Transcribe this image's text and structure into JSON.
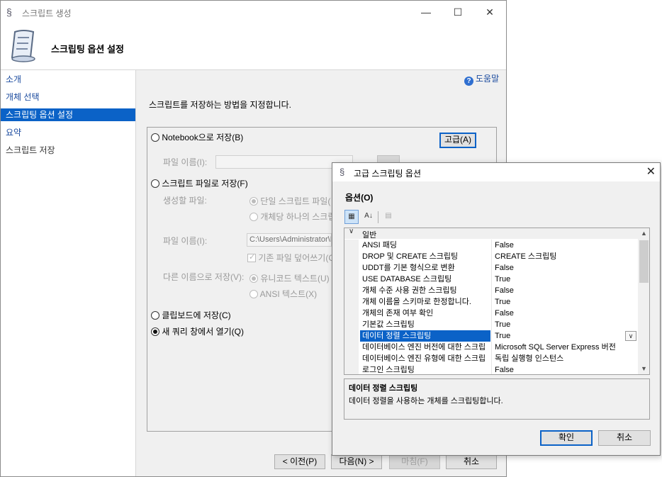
{
  "main_window": {
    "title": "스크립트 생성",
    "header_title": "스크립팅 옵션 설정",
    "sidebar": [
      {
        "label": "소개"
      },
      {
        "label": "개체 선택"
      },
      {
        "label": "스크립팅 옵션 설정"
      },
      {
        "label": "요약"
      },
      {
        "label": "스크립트 저장"
      }
    ],
    "help_label": "도움말",
    "instruction": "스크립트를 저장하는 방법을 지정합니다.",
    "options": {
      "notebook_label": "Notebook으로 저장(B)",
      "advanced_button": "고급(A)",
      "file_name_label_1": "파일 이름(I):",
      "script_file_label": "스크립트 파일로 저장(F)",
      "files_to_generate_label": "생성할 파일:",
      "single_script_label": "단일 스크립트 파일(",
      "one_per_object_label": "개체당 하나의 스크립",
      "file_name_label_2": "파일 이름(I):",
      "file_name_value": "C:\\Users\\Administrator\\D",
      "overwrite_label": "기존 파일 덮어쓰기(C",
      "save_as_label": "다른 이름으로 저장(V):",
      "unicode_label": "유니코드 텍스트(U)",
      "ansi_label": "ANSI 텍스트(X)",
      "clipboard_label": "클립보드에 저장(C)",
      "new_query_label": "새 쿼리 창에서 열기(Q)"
    },
    "footer": {
      "prev": "< 이전(P)",
      "next": "다음(N) >",
      "finish": "마침(F)",
      "cancel": "취소"
    }
  },
  "advanced_dialog": {
    "title": "고급 스크립팅 옵션",
    "options_label": "옵션(O)",
    "category": "일반",
    "properties": [
      {
        "name": "ANSI 패딩",
        "value": "False"
      },
      {
        "name": "DROP 및 CREATE 스크립팅",
        "value": "CREATE 스크립팅"
      },
      {
        "name": "UDDT를 기본 형식으로 변환",
        "value": "False"
      },
      {
        "name": "USE DATABASE 스크립팅",
        "value": "True"
      },
      {
        "name": "개체 수준 사용 권한 스크립팅",
        "value": "False"
      },
      {
        "name": "개체 이름을 스키마로 한정합니다.",
        "value": "True"
      },
      {
        "name": "개체의 존재 여부 확인",
        "value": "False"
      },
      {
        "name": "기본값 스크립팅",
        "value": "True"
      },
      {
        "name": "데이터 정렬 스크립팅",
        "value": "True"
      },
      {
        "name": "데이터베이스 엔진 버전에 대한 스크립",
        "value": "Microsoft SQL Server Express 버전"
      },
      {
        "name": "데이터베이스 엔진 유형에 대한 스크립",
        "value": "독립 실행형 인스턴스"
      },
      {
        "name": "로그인 스크립팅",
        "value": "False"
      }
    ],
    "description_title": "데이터 정렬 스크립팅",
    "description_text": "데이터 정렬을 사용하는 개체를 스크립팅합니다.",
    "ok": "확인",
    "cancel": "취소"
  },
  "colors": {
    "accent": "#0b62c7",
    "link": "#1a4a9e"
  }
}
